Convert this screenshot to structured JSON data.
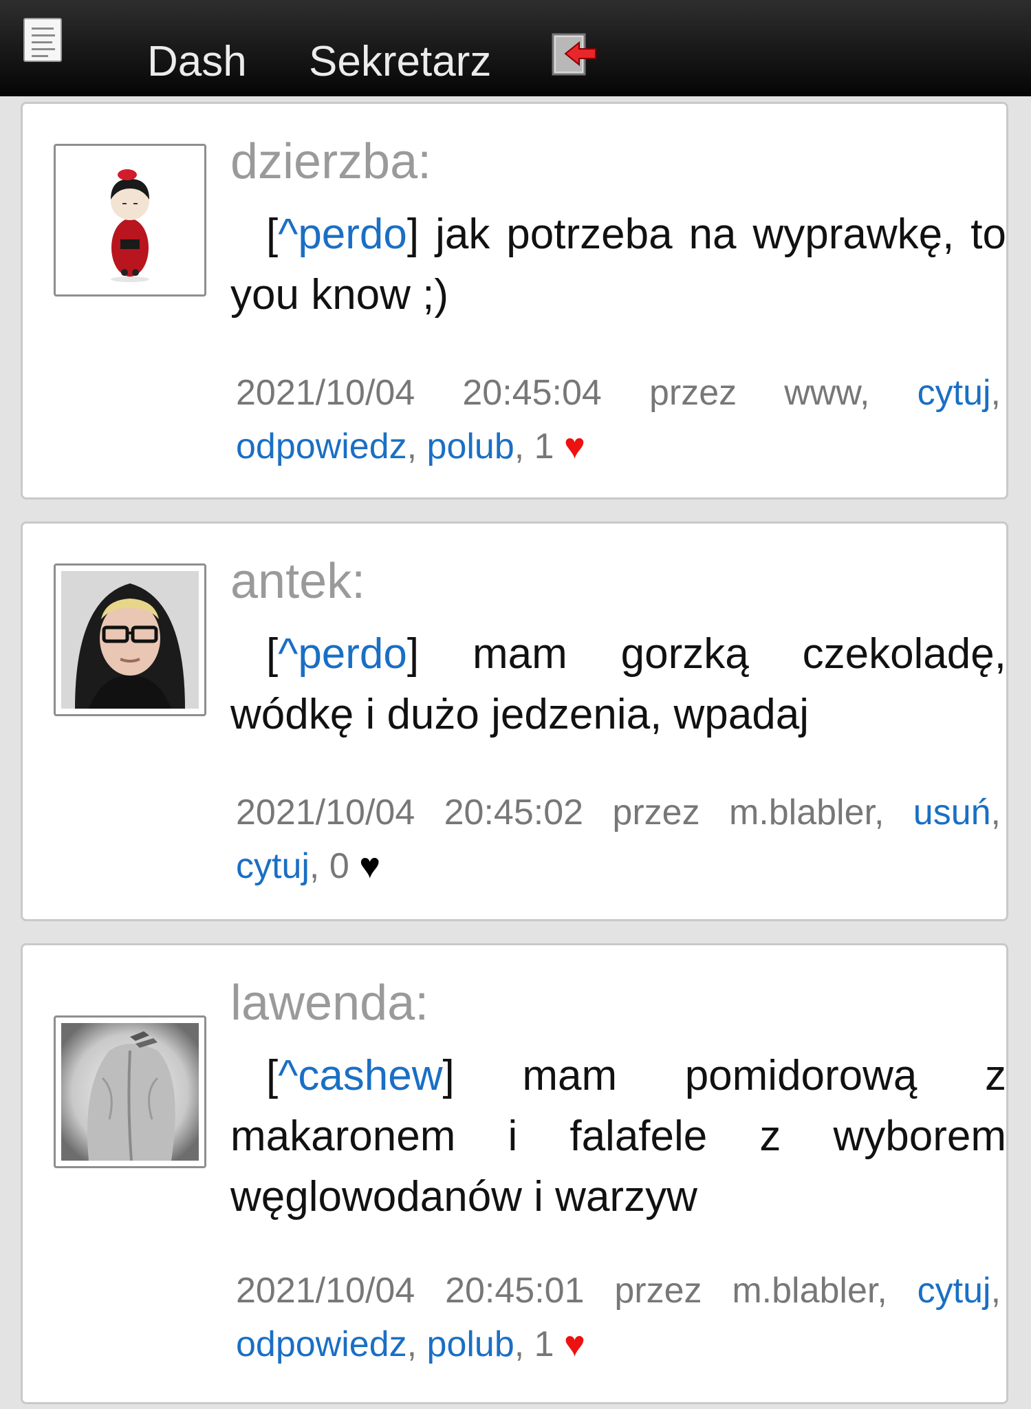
{
  "nav": {
    "dash_label": "Dash",
    "sekretarz_label": "Sekretarz"
  },
  "posts": [
    {
      "author": "dzierzba:",
      "mention": "^perdo",
      "text": "jak potrzeba na wyprawkę, to you know ;)",
      "timestamp": "2021/10/04 20:45:04",
      "via": "przez www,",
      "actions": [
        "cytuj",
        "odpowiedz",
        "polub"
      ],
      "likes": "1",
      "heart_color": "#ee1111"
    },
    {
      "author": "antek:",
      "mention": "^perdo",
      "text": "mam gorzką czekoladę, wódkę i dużo jedzenia, wpadaj",
      "timestamp": "2021/10/04 20:45:02",
      "via": "przez m.blabler,",
      "actions": [
        "usuń",
        "cytuj"
      ],
      "likes": "0",
      "heart_color": "#000000"
    },
    {
      "author": "lawenda:",
      "mention": "^cashew",
      "text": "mam pomidorową z makaronem i falafele z wyborem węglowodanów i warzyw",
      "timestamp": "2021/10/04 20:45:01",
      "via": "przez m.blabler,",
      "actions": [
        "cytuj",
        "odpowiedz",
        "polub"
      ],
      "likes": "1",
      "heart_color": "#ee1111"
    }
  ],
  "heart_glyph": "♥"
}
